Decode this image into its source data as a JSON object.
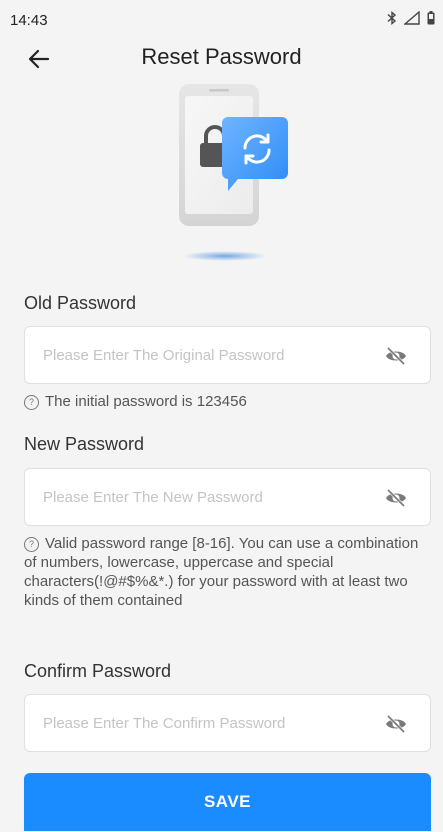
{
  "status_bar": {
    "time": "14:43",
    "icons": [
      "bluetooth-icon",
      "signal-icon",
      "battery-icon"
    ]
  },
  "header": {
    "title": "Reset Password",
    "back_icon": "arrow-left-icon"
  },
  "illustration": {
    "icon": "phone-lock-sync-icon"
  },
  "form": {
    "old_password": {
      "label": "Old Password",
      "placeholder": "Please Enter The Original Password",
      "value": "",
      "hint": "The initial password is 123456"
    },
    "new_password": {
      "label": "New Password",
      "placeholder": "Please Enter The New Password",
      "value": "",
      "hint": "Valid password range [8-16]. You can use a combination of numbers, lowercase, uppercase and special characters(!@#$%&*.) for your password with at least two kinds of them contained"
    },
    "confirm_password": {
      "label": "Confirm Password",
      "placeholder": "Please Enter The Confirm Password",
      "value": ""
    },
    "hint_icon_glyph": "?"
  },
  "actions": {
    "save_label": "SAVE"
  },
  "colors": {
    "accent": "#1a8cff",
    "background": "#f4f4f4",
    "input_border": "#e0e0e0",
    "placeholder": "#c4c4c4"
  }
}
